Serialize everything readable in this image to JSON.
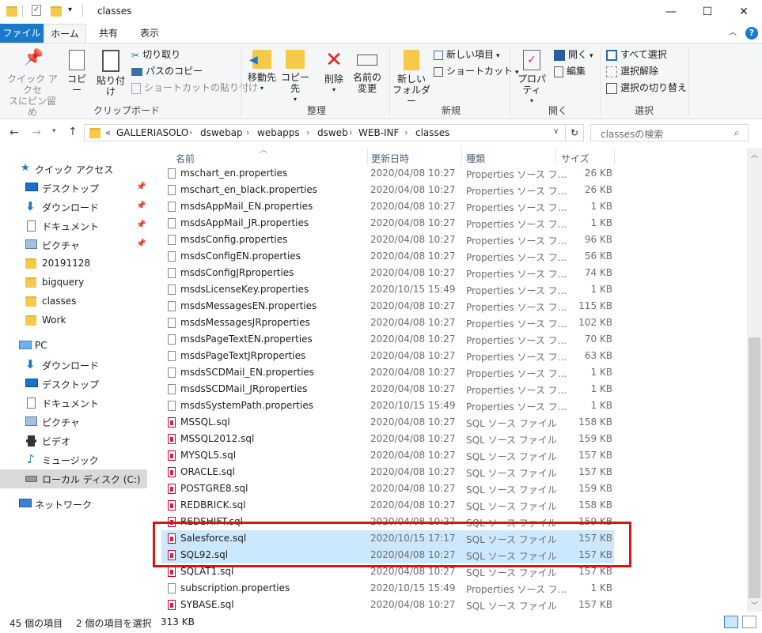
{
  "window": {
    "title": "classes",
    "controls": {
      "minimize": "—",
      "maximize": "☐",
      "close": "✕"
    }
  },
  "tabs": [
    {
      "label": "ファイル"
    },
    {
      "label": "ホーム"
    },
    {
      "label": "共有"
    },
    {
      "label": "表示"
    }
  ],
  "ribbon": {
    "clipboard": {
      "pin_label_1": "クイック アクセ",
      "pin_label_2": "スにピン留め",
      "copy": "コピー",
      "paste": "貼り付け",
      "cut": "切り取り",
      "copy_path": "パスのコピー",
      "paste_shortcut": "ショートカットの貼り付け",
      "group": "クリップボード"
    },
    "organize": {
      "move_to": "移動先",
      "copy_to": "コピー先",
      "delete": "削除",
      "rename_1": "名前の",
      "rename_2": "変更",
      "group": "整理"
    },
    "new": {
      "new_folder_1": "新しい",
      "new_folder_2": "フォルダー",
      "new_item": "新しい項目",
      "shortcut": "ショートカット",
      "group": "新規"
    },
    "open": {
      "properties": "プロパティ",
      "open": "開く",
      "edit": "編集",
      "group": "開く"
    },
    "select": {
      "select_all": "すべて選択",
      "select_none": "選択解除",
      "invert": "選択の切り替え",
      "group": "選択"
    }
  },
  "address": {
    "prefix": "«",
    "crumbs": [
      "GALLERIASOLO",
      "dswebap",
      "webapps",
      "dsweb",
      "WEB-INF",
      "classes"
    ],
    "search_placeholder": "classesの検索"
  },
  "nav": {
    "quick_access": "クイック アクセス",
    "quick_items": [
      "デスクトップ",
      "ダウンロード",
      "ドキュメント",
      "ピクチャ",
      "20191128",
      "bigquery",
      "classes",
      "Work"
    ],
    "pc": "PC",
    "pc_items": [
      "ダウンロード",
      "デスクトップ",
      "ドキュメント",
      "ピクチャ",
      "ビデオ",
      "ミュージック",
      "ローカル ディスク (C:)"
    ],
    "network": "ネットワーク"
  },
  "columns": {
    "name": "名前",
    "date": "更新日時",
    "type": "種類",
    "size": "サイズ"
  },
  "files": [
    {
      "name": "mschart_en.properties",
      "date": "2020/04/08 10:27",
      "type": "Properties ソース フ...",
      "size": "26 KB",
      "kind": "doc"
    },
    {
      "name": "mschart_en_black.properties",
      "date": "2020/04/08 10:27",
      "type": "Properties ソース フ...",
      "size": "26 KB",
      "kind": "doc"
    },
    {
      "name": "msdsAppMail_EN.properties",
      "date": "2020/04/08 10:27",
      "type": "Properties ソース フ...",
      "size": "1 KB",
      "kind": "doc"
    },
    {
      "name": "msdsAppMail_JR.properties",
      "date": "2020/04/08 10:27",
      "type": "Properties ソース フ...",
      "size": "1 KB",
      "kind": "doc"
    },
    {
      "name": "msdsConfig.properties",
      "date": "2020/04/08 10:27",
      "type": "Properties ソース フ...",
      "size": "96 KB",
      "kind": "doc"
    },
    {
      "name": "msdsConfigEN.properties",
      "date": "2020/04/08 10:27",
      "type": "Properties ソース フ...",
      "size": "56 KB",
      "kind": "doc"
    },
    {
      "name": "msdsConfigJRproperties",
      "date": "2020/04/08 10:27",
      "type": "Properties ソース フ...",
      "size": "74 KB",
      "kind": "doc"
    },
    {
      "name": "msdsLicenseKey.properties",
      "date": "2020/10/15 15:49",
      "type": "Properties ソース フ...",
      "size": "1 KB",
      "kind": "doc"
    },
    {
      "name": "msdsMessagesEN.properties",
      "date": "2020/04/08 10:27",
      "type": "Properties ソース フ...",
      "size": "115 KB",
      "kind": "doc"
    },
    {
      "name": "msdsMessagesJRproperties",
      "date": "2020/04/08 10:27",
      "type": "Properties ソース フ...",
      "size": "102 KB",
      "kind": "doc"
    },
    {
      "name": "msdsPageTextEN.properties",
      "date": "2020/04/08 10:27",
      "type": "Properties ソース フ...",
      "size": "70 KB",
      "kind": "doc"
    },
    {
      "name": "msdsPageTextJRproperties",
      "date": "2020/04/08 10:27",
      "type": "Properties ソース フ...",
      "size": "63 KB",
      "kind": "doc"
    },
    {
      "name": "msdsSCDMail_EN.properties",
      "date": "2020/04/08 10:27",
      "type": "Properties ソース フ...",
      "size": "1 KB",
      "kind": "doc"
    },
    {
      "name": "msdsSCDMail_JRproperties",
      "date": "2020/04/08 10:27",
      "type": "Properties ソース フ...",
      "size": "1 KB",
      "kind": "doc"
    },
    {
      "name": "msdsSystemPath.properties",
      "date": "2020/10/15 15:49",
      "type": "Properties ソース フ...",
      "size": "1 KB",
      "kind": "doc"
    },
    {
      "name": "MSSQL.sql",
      "date": "2020/04/08 10:27",
      "type": "SQL ソース ファイル",
      "size": "158 KB",
      "kind": "sql"
    },
    {
      "name": "MSSQL2012.sql",
      "date": "2020/04/08 10:27",
      "type": "SQL ソース ファイル",
      "size": "159 KB",
      "kind": "sql"
    },
    {
      "name": "MYSQL5.sql",
      "date": "2020/04/08 10:27",
      "type": "SQL ソース ファイル",
      "size": "157 KB",
      "kind": "sql"
    },
    {
      "name": "ORACLE.sql",
      "date": "2020/04/08 10:27",
      "type": "SQL ソース ファイル",
      "size": "157 KB",
      "kind": "sql"
    },
    {
      "name": "POSTGRE8.sql",
      "date": "2020/04/08 10:27",
      "type": "SQL ソース ファイル",
      "size": "159 KB",
      "kind": "sql"
    },
    {
      "name": "REDBRICK.sql",
      "date": "2020/04/08 10:27",
      "type": "SQL ソース ファイル",
      "size": "158 KB",
      "kind": "sql"
    },
    {
      "name": "REDSHIFT.sql",
      "date": "2020/04/08 10:27",
      "type": "SQL ソース ファイル",
      "size": "159 KB",
      "kind": "sql"
    },
    {
      "name": "Salesforce.sql",
      "date": "2020/10/15 17:17",
      "type": "SQL ソース ファイル",
      "size": "157 KB",
      "kind": "sql",
      "selected": true
    },
    {
      "name": "SQL92.sql",
      "date": "2020/04/08 10:27",
      "type": "SQL ソース ファイル",
      "size": "157 KB",
      "kind": "sql",
      "selected": true
    },
    {
      "name": "SQLAT1.sql",
      "date": "2020/04/08 10:27",
      "type": "SQL ソース ファイル",
      "size": "157 KB",
      "kind": "sql"
    },
    {
      "name": "subscription.properties",
      "date": "2020/10/15 15:49",
      "type": "Properties ソース フ...",
      "size": "1 KB",
      "kind": "doc"
    },
    {
      "name": "SYBASE.sql",
      "date": "2020/04/08 10:27",
      "type": "SQL ソース ファイル",
      "size": "157 KB",
      "kind": "sql"
    }
  ],
  "status": {
    "item_count": "45 個の項目",
    "selected": "2 個の項目を選択",
    "selected_size": "313 KB"
  },
  "colors": {
    "accent": "#1979ca",
    "selection": "#cce8ff",
    "highlight_box": "#d01818"
  }
}
